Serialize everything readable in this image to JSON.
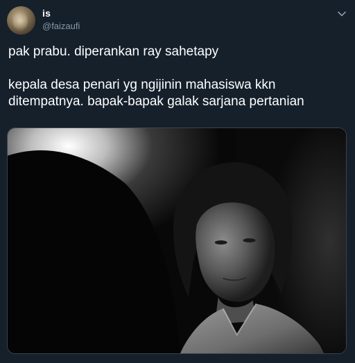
{
  "tweet": {
    "display_name": "is",
    "handle": "@faizaufi",
    "lines": [
      "pak prabu. diperankan ray sahetapy",
      "",
      "kepala desa penari yg ngijinin mahasiswa kkn",
      "ditempatnya. bapak-bapak galak sarjana pertanian"
    ]
  },
  "icons": {
    "more": "chevron-down-icon"
  },
  "colors": {
    "background": "#15202b",
    "text": "#ffffff",
    "secondary_text": "#8899a6",
    "border": "#38444d"
  }
}
